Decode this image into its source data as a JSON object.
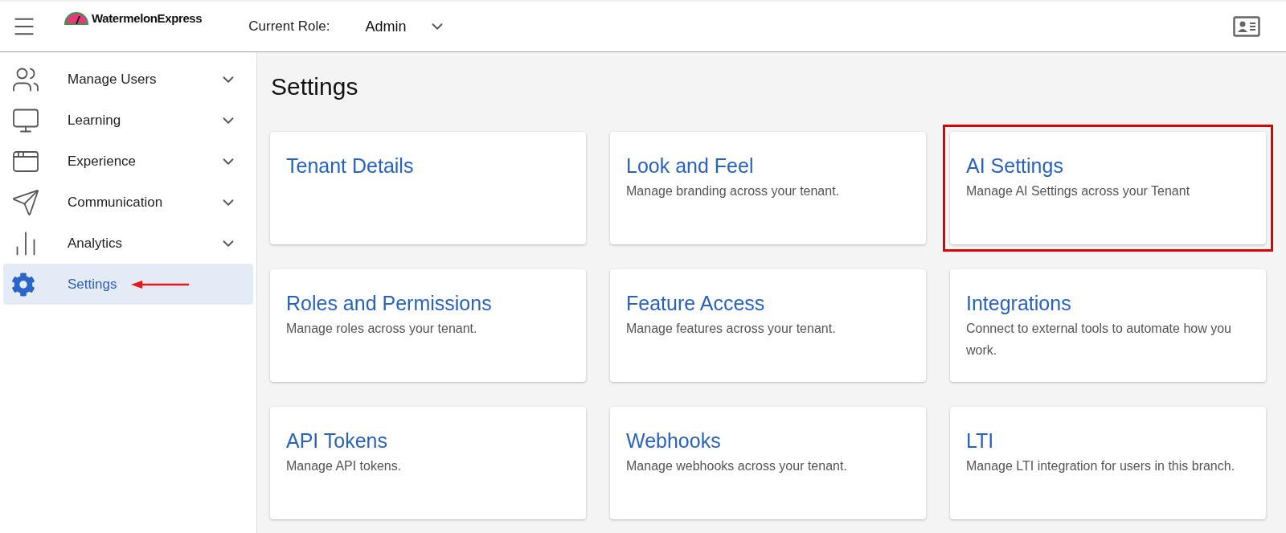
{
  "header": {
    "logo_text": "WatermelonExpress",
    "role_label": "Current Role:",
    "role_value": "Admin"
  },
  "sidebar": {
    "items": [
      {
        "label": "Manage Users",
        "kind": "users",
        "selected": false,
        "expandable": true,
        "pointer": false
      },
      {
        "label": "Learning",
        "kind": "monitor",
        "selected": false,
        "expandable": true,
        "pointer": false
      },
      {
        "label": "Experience",
        "kind": "window",
        "selected": false,
        "expandable": true,
        "pointer": false
      },
      {
        "label": "Communication",
        "kind": "send",
        "selected": false,
        "expandable": true,
        "pointer": false
      },
      {
        "label": "Analytics",
        "kind": "chart",
        "selected": false,
        "expandable": true,
        "pointer": false
      },
      {
        "label": "Settings",
        "kind": "gear",
        "selected": true,
        "expandable": false,
        "pointer": true
      }
    ]
  },
  "page_title": "Settings",
  "cards": [
    {
      "title": "Tenant Details",
      "highlighted": false
    },
    {
      "title": "Look and Feel",
      "description": "Manage branding across your tenant.",
      "highlighted": false
    },
    {
      "title": "AI Settings",
      "description": "Manage AI Settings across your Tenant",
      "highlighted": true
    },
    {
      "title": "Roles and Permissions",
      "description": "Manage roles across your tenant.",
      "highlighted": false
    },
    {
      "title": "Feature Access",
      "description": "Manage features across your tenant.",
      "highlighted": false
    },
    {
      "title": "Integrations",
      "description": "Connect to external tools to automate how you work.",
      "highlighted": false
    },
    {
      "title": "API Tokens",
      "description": "Manage API tokens.",
      "highlighted": false
    },
    {
      "title": "Webhooks",
      "description": "Manage webhooks across your tenant.",
      "highlighted": false
    },
    {
      "title": "LTI",
      "description": "Manage LTI integration for users in this branch.",
      "highlighted": false
    }
  ]
}
